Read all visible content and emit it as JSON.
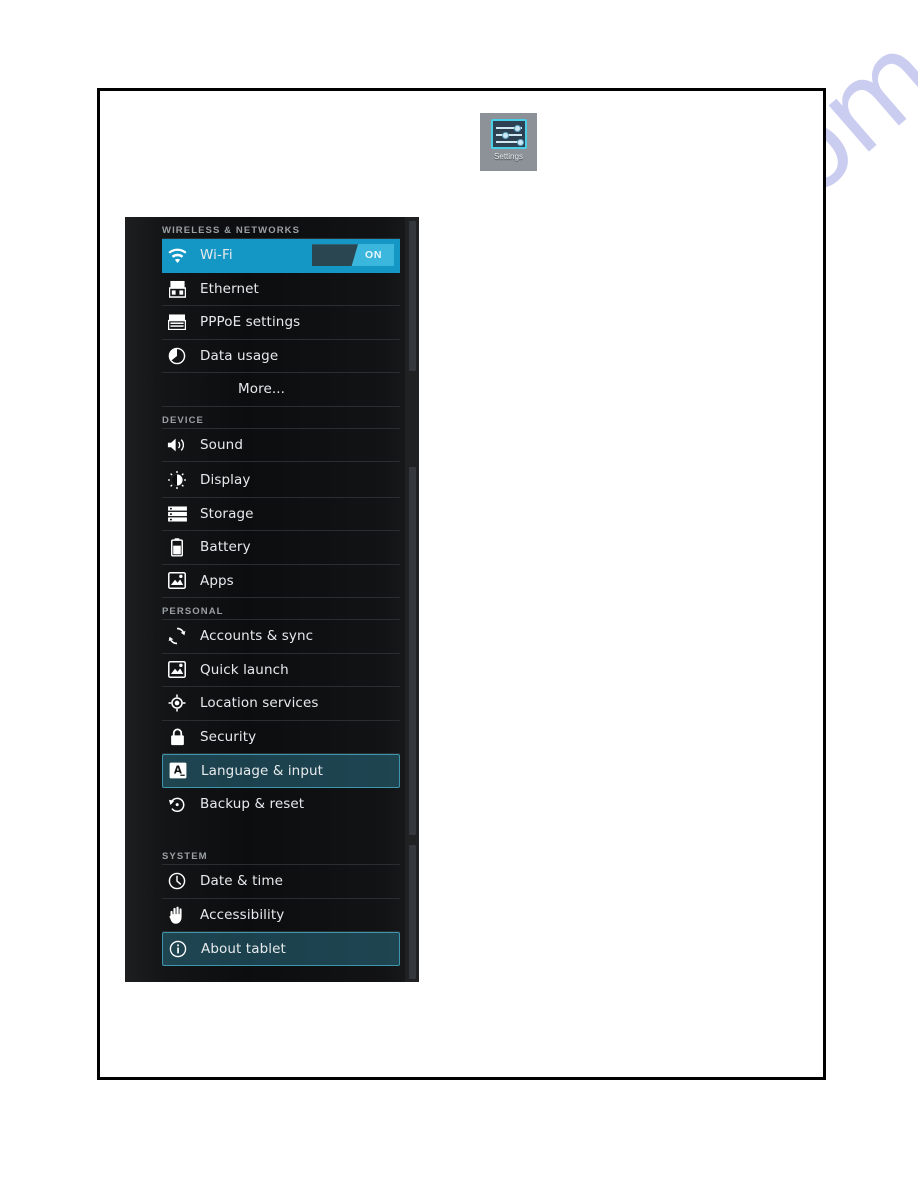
{
  "launcher": {
    "label": "Settings",
    "icon": "settings-sliders-icon"
  },
  "watermark": {
    "text": "manualshive.com",
    "color": "#b9bcec"
  },
  "colors": {
    "selected_blue": "#1597c6",
    "selected_teal_border": "#3e96ad",
    "panel_background": "#141517",
    "row_text": "#e7eaec",
    "header_text": "#9aa0a4"
  },
  "settings": {
    "wifi_toggle": {
      "state_label": "ON",
      "name": "wifi-toggle"
    },
    "sections": [
      {
        "header": "WIRELESS & NETWORKS",
        "items": [
          {
            "label": "Wi-Fi",
            "icon": "wifi-icon",
            "state": "selected-blue",
            "has_toggle": true
          },
          {
            "label": "Ethernet",
            "icon": "ethernet-icon",
            "state": "normal",
            "has_toggle": false
          },
          {
            "label": "PPPoE settings",
            "icon": "adsl-icon",
            "state": "normal",
            "has_toggle": false
          },
          {
            "label": "Data usage",
            "icon": "data-usage-icon",
            "state": "normal",
            "has_toggle": false
          },
          {
            "label": "More...",
            "icon": "none",
            "state": "indent",
            "has_toggle": false
          }
        ]
      },
      {
        "header": "DEVICE",
        "items": [
          {
            "label": "Sound",
            "icon": "sound-icon",
            "state": "normal",
            "has_toggle": false
          },
          {
            "label": "Display",
            "icon": "display-icon",
            "state": "normal",
            "has_toggle": false
          },
          {
            "label": "Storage",
            "icon": "storage-icon",
            "state": "normal",
            "has_toggle": false
          },
          {
            "label": "Battery",
            "icon": "battery-icon",
            "state": "normal",
            "has_toggle": false
          },
          {
            "label": "Apps",
            "icon": "apps-icon",
            "state": "normal",
            "has_toggle": false
          }
        ]
      },
      {
        "header": "PERSONAL",
        "items": [
          {
            "label": "Accounts & sync",
            "icon": "sync-icon",
            "state": "normal",
            "has_toggle": false
          },
          {
            "label": "Quick launch",
            "icon": "apps-icon",
            "state": "normal",
            "has_toggle": false
          },
          {
            "label": "Location services",
            "icon": "location-icon",
            "state": "normal",
            "has_toggle": false
          },
          {
            "label": "Security",
            "icon": "lock-icon",
            "state": "normal",
            "has_toggle": false
          },
          {
            "label": "Language & input",
            "icon": "language-icon",
            "state": "selected-teal",
            "has_toggle": false
          },
          {
            "label": "Backup & reset",
            "icon": "backup-icon",
            "state": "normal",
            "has_toggle": false
          }
        ]
      },
      {
        "header": "SYSTEM",
        "items": [
          {
            "label": "Date & time",
            "icon": "clock-icon",
            "state": "normal",
            "has_toggle": false
          },
          {
            "label": "Accessibility",
            "icon": "accessibility-icon",
            "state": "normal",
            "has_toggle": false
          },
          {
            "label": "About tablet",
            "icon": "info-icon",
            "state": "selected-teal",
            "has_toggle": false
          }
        ]
      }
    ]
  }
}
